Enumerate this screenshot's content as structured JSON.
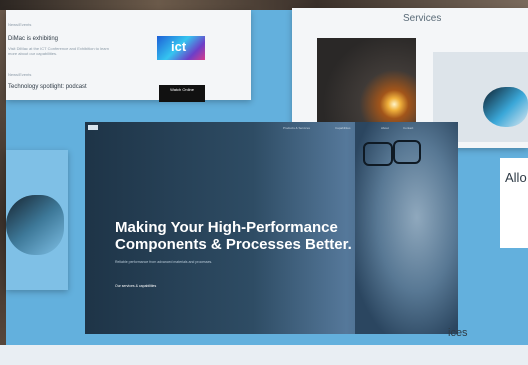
{
  "top_left_panel": {
    "section_label_1": "News/Events",
    "headline_1": "DiMac is exhibiting",
    "body_1": "Visit DiMac at the ICT Conference and Exhibition to learn more about our capabilities.",
    "section_label_2": "News/Events",
    "headline_2": "Technology spotlight: podcast",
    "logo_text": "ict",
    "badge_text": "Watch Online"
  },
  "services_panel": {
    "title": "Services"
  },
  "hero": {
    "nav_items": [
      "Products & Services",
      "Capabilities",
      "About",
      "Contact"
    ],
    "headline_line_1": "Making Your High-Performance",
    "headline_line_2": "Components & Processes Better.",
    "subcopy": "Reliable performance from advanced materials and processes.",
    "cta": "Our services & capabilities"
  },
  "right_card": {
    "title": "Allo"
  },
  "bottom_strip": {
    "partial_title": "ices"
  }
}
